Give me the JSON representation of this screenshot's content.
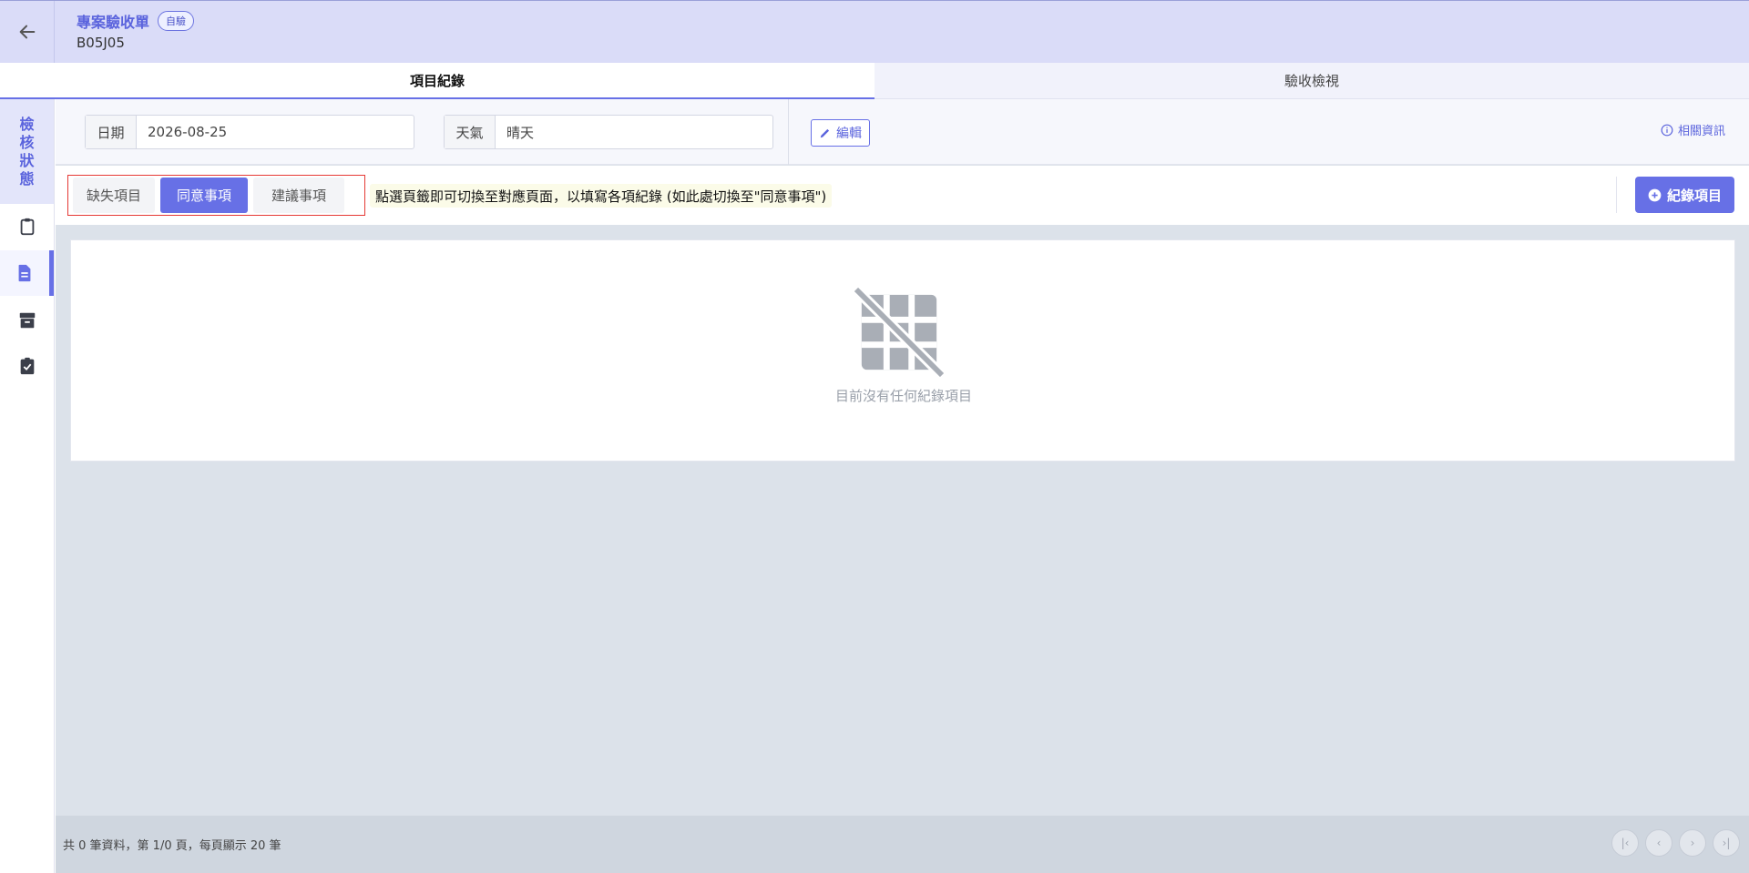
{
  "header": {
    "title": "專案驗收單",
    "badge": "自驗",
    "code": "B05J05"
  },
  "tabs": [
    {
      "label": "項目紀錄",
      "active": true
    },
    {
      "label": "驗收檢視",
      "active": false
    }
  ],
  "sidebar": {
    "status_chars": [
      "檢",
      "核",
      "狀",
      "態"
    ],
    "items": [
      {
        "icon": "clipboard-icon",
        "active": false
      },
      {
        "icon": "document-icon",
        "active": true
      },
      {
        "icon": "archive-icon",
        "active": false
      },
      {
        "icon": "clipboard-check-icon",
        "active": false
      }
    ]
  },
  "info": {
    "date_label": "日期",
    "date_value": "2026-08-25",
    "weather_label": "天氣",
    "weather_value": "晴天",
    "edit_label": "編輯",
    "related_label": "相關資訊"
  },
  "subtabs": [
    {
      "label": "缺失項目",
      "active": false
    },
    {
      "label": "同意事項",
      "active": true
    },
    {
      "label": "建議事項",
      "active": false
    }
  ],
  "hint": "點選頁籤即可切換至對應頁面，以填寫各項紀錄 (如此處切換至\"同意事項\")",
  "add_button": "紀錄項目",
  "empty_text": "目前沒有任何紀錄項目",
  "footer": {
    "summary": "共 0 筆資料，第 1/0 頁，每頁顯示 20 筆",
    "pager": [
      "first-page-icon",
      "prev-page-icon",
      "next-page-icon",
      "last-page-icon"
    ]
  },
  "colors": {
    "accent": "#6770e6",
    "header_bg": "#dadcf8",
    "alert_border": "#e53935"
  }
}
